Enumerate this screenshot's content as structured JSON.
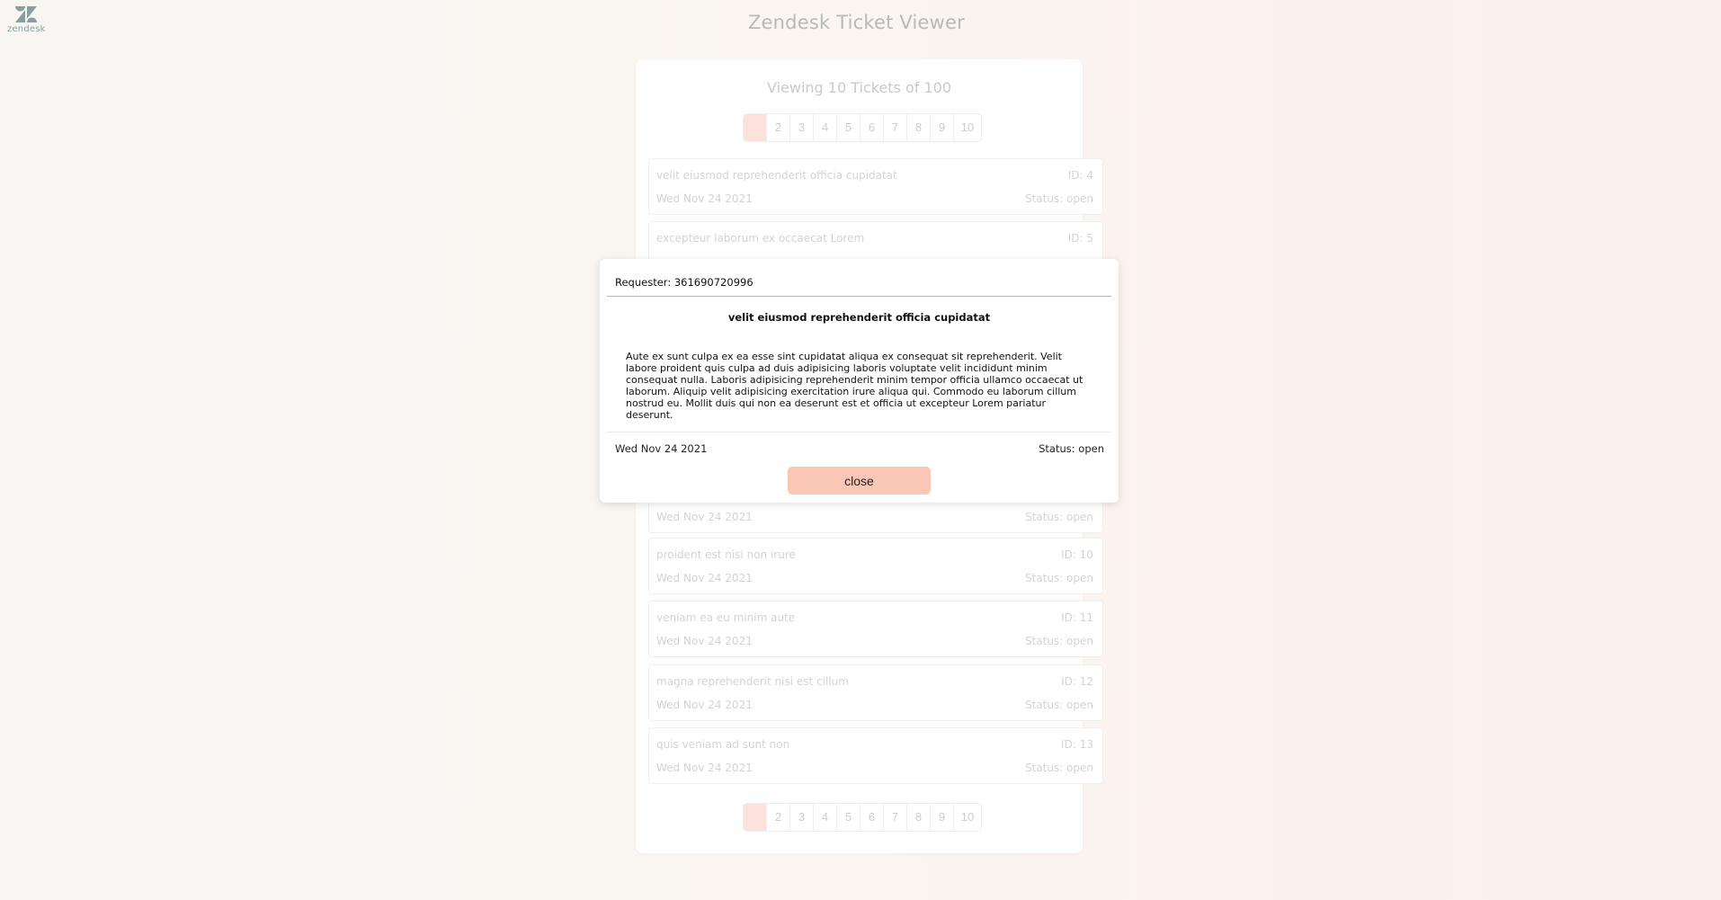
{
  "logo": {
    "text": "zendesk"
  },
  "app_title": "Zendesk Ticket Viewer",
  "viewing_text": "Viewing 10 Tickets of 100",
  "pagination": {
    "pages": [
      "1",
      "2",
      "3",
      "4",
      "5",
      "6",
      "7",
      "8",
      "9",
      "10"
    ],
    "active": "1"
  },
  "tickets": [
    {
      "subject": "velit eiusmod reprehenderit officia cupidatat",
      "id": "ID: 4",
      "date": "Wed Nov 24 2021",
      "status": "Status: open"
    },
    {
      "subject": "excepteur laborum ex occaecat Lorem",
      "id": "ID: 5",
      "date": "",
      "status": ""
    },
    {
      "subject": "",
      "id": "",
      "date": "Wed Nov 24 2021",
      "status": "Status: open"
    },
    {
      "subject": "proident est nisi non irure",
      "id": "ID: 10",
      "date": "Wed Nov 24 2021",
      "status": "Status: open"
    },
    {
      "subject": "veniam ea eu minim aute",
      "id": "ID: 11",
      "date": "Wed Nov 24 2021",
      "status": "Status: open"
    },
    {
      "subject": "magna reprehenderit nisi est cillum",
      "id": "ID: 12",
      "date": "Wed Nov 24 2021",
      "status": "Status: open"
    },
    {
      "subject": "quis veniam ad sunt non",
      "id": "ID: 13",
      "date": "Wed Nov 24 2021",
      "status": "Status: open"
    }
  ],
  "modal": {
    "requester": "Requester: 361690720996",
    "subject": "velit eiusmod reprehenderit officia cupidatat",
    "description": "Aute ex sunt culpa ex ea esse sint cupidatat aliqua ex consequat sit reprehenderit. Velit labore proident quis culpa ad duis adipisicing laboris voluptate velit incididunt minim consequat nulla. Laboris adipisicing reprehenderit minim tempor officia ullamco occaecat ut laborum. Aliquip velit adipisicing exercitation irure aliqua qui. Commodo eu laborum cillum nostrud eu. Mollit duis qui non ea deserunt est et officia ut excepteur Lorem pariatur deserunt.",
    "date": "Wed Nov 24 2021",
    "status": "Status: open",
    "close_label": "close"
  },
  "colors": {
    "accent": "#fac6b5",
    "active_page": "#fbe3dc",
    "muted_text": "#d3d3d3"
  }
}
